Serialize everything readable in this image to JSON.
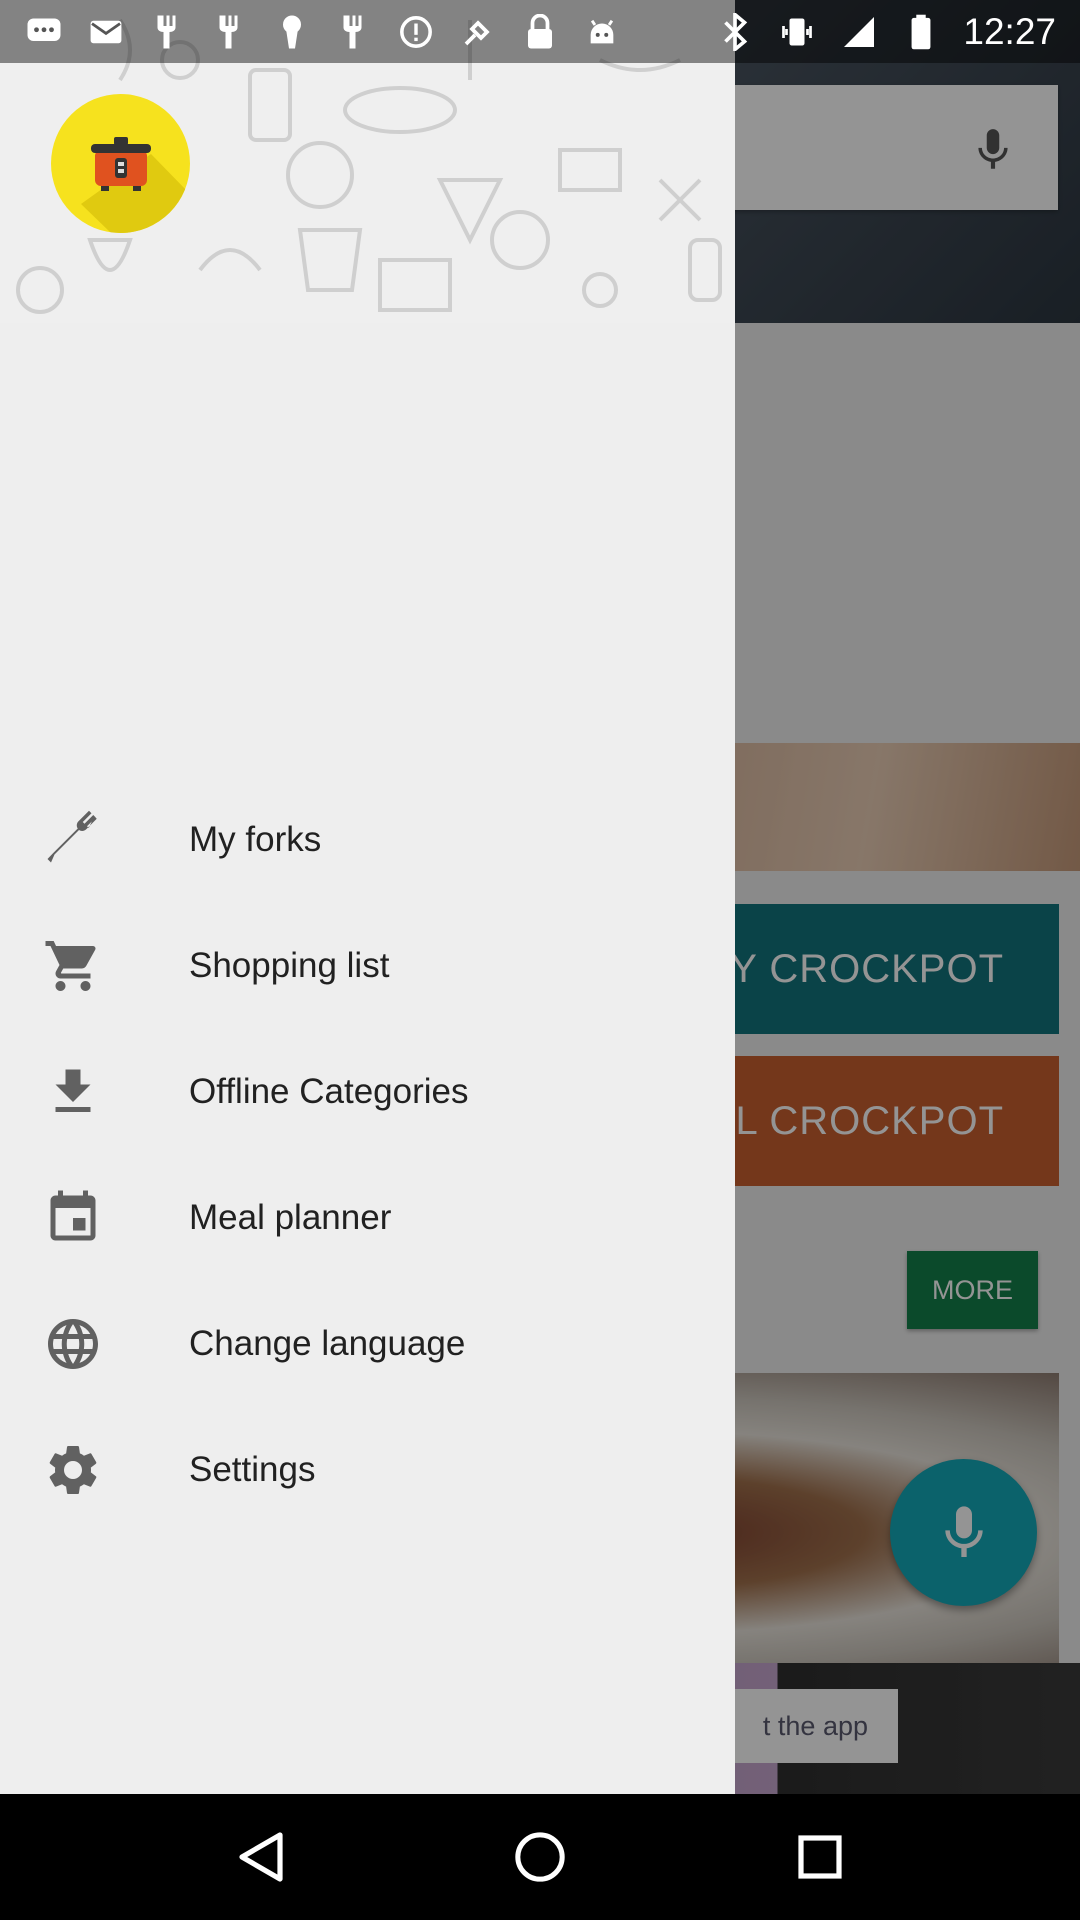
{
  "status_bar": {
    "time": "12:27",
    "left_icons": [
      "chat-icon",
      "mail-icon",
      "fork-icon",
      "fork-icon",
      "keyhole-icon",
      "fork-icon",
      "alert-icon",
      "satellite-icon",
      "lock-icon",
      "android-icon"
    ],
    "right_icons": [
      "bluetooth-icon",
      "vibrate-icon",
      "signal-icon",
      "battery-icon"
    ]
  },
  "drawer": {
    "logo": "crockpot-logo",
    "menu": [
      {
        "label": "My forks",
        "icon": "fork-icon"
      },
      {
        "label": "Shopping list",
        "icon": "cart-icon"
      },
      {
        "label": "Offline Categories",
        "icon": "download-icon"
      },
      {
        "label": "Meal planner",
        "icon": "calendar-icon"
      },
      {
        "label": "Change language",
        "icon": "globe-icon"
      },
      {
        "label": "Settings",
        "icon": "gear-icon"
      }
    ]
  },
  "background": {
    "teal_button": "Y CROCKPOT",
    "orange_button": "NAL CROCKPOT",
    "more_button": "MORE",
    "ad_button": "t the app"
  },
  "colors": {
    "drawer_bg": "#eeeeee",
    "logo_yellow": "#f6e21e",
    "teal": "#12747d",
    "orange": "#c8602f",
    "green": "#14804a",
    "fab": "#13a9b8"
  }
}
